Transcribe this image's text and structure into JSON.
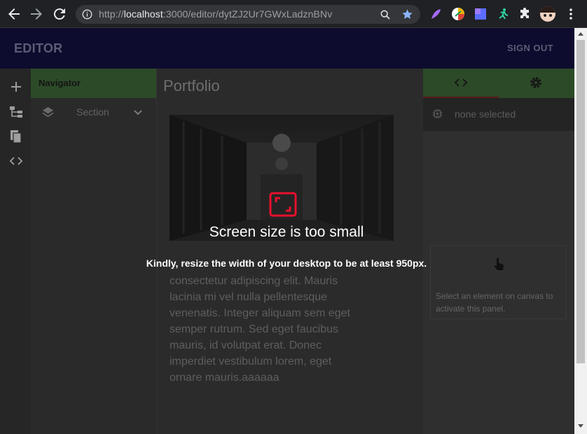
{
  "browser": {
    "url_scheme": "http://",
    "url_host": "localhost",
    "url_path": ":3000/editor/dytZJ2Ur7GWxLadznBNv"
  },
  "header": {
    "title": "EDITOR",
    "signout_label": "SIGN OUT"
  },
  "navigator": {
    "title": "Navigator",
    "items": [
      {
        "label": "Section"
      }
    ]
  },
  "canvas": {
    "title": "Portfolio",
    "paragraph": "consectetur adipiscing elit. Mauris lacinia mi vel nulla pellentesque venenatis. Integer aliquam sem eget semper rutrum. Sed eget faucibus mauris, id volutpat erat. Donec imperdiet vestibulum lorem, eget ornare mauris.aaaaaa"
  },
  "right_panel": {
    "none_selected": "none selected",
    "hint": "Select an element on canvas to activate this panel."
  },
  "overlay": {
    "title": "Screen size is too small",
    "message": "Kindly, resize the width of your desktop to be at least 950px."
  },
  "colors": {
    "accent_green": "#2c4a28",
    "header_bg": "#0d0b2e",
    "overlay_icon": "#e8112d"
  }
}
